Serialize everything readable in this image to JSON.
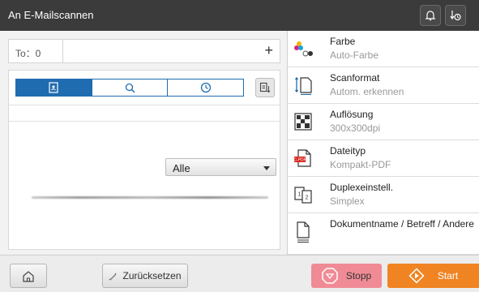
{
  "header": {
    "title": "An E-Mailscannen"
  },
  "address": {
    "to_label": "To：0",
    "add_symbol": "+"
  },
  "filter": {
    "selected": "Alle"
  },
  "settings": [
    {
      "label": "Farbe",
      "value": "Auto-Farbe",
      "icon": "color-dots-icon"
    },
    {
      "label": "Scanformat",
      "value": "Autom. erkennen",
      "icon": "scan-size-icon"
    },
    {
      "label": "Auflösung",
      "value": "300x300dpi",
      "icon": "resolution-icon"
    },
    {
      "label": "Dateityp",
      "value": "Kompakt-PDF",
      "icon": "pdf-file-icon"
    },
    {
      "label": "Duplexeinstell.",
      "value": "Simplex",
      "icon": "duplex-icon"
    },
    {
      "label": "Dokumentname / Betreff / Andere",
      "value": "",
      "icon": "document-icon"
    }
  ],
  "footer": {
    "reset_label": "Zurücksetzen",
    "stop_label": "Stopp",
    "start_label": "Start"
  },
  "colors": {
    "accent": "#1f6cb0",
    "stop": "#f08b96",
    "start": "#f08422",
    "header": "#3b3b3b"
  }
}
